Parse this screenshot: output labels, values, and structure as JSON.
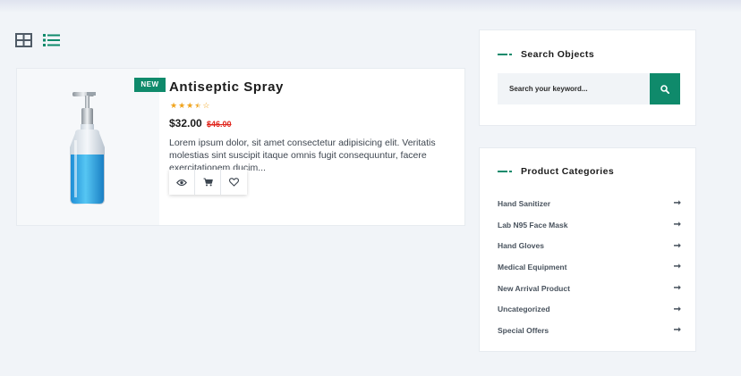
{
  "view_toggle": {
    "grid_icon": "grid-view-icon",
    "list_icon": "list-view-icon",
    "active": "list"
  },
  "product": {
    "badge": "NEW",
    "title": "Antiseptic Spray",
    "rating": 3.5,
    "rating_max": 5,
    "price": "$32.00",
    "old_price": "$46.00",
    "description": "Lorem ipsum dolor, sit amet consectetur adipisicing elit. Veritatis molestias sint suscipit itaque omnis fugit consequuntur, facere exercitationem ducim...",
    "actions": [
      "eye-icon",
      "cart-icon",
      "heart-icon"
    ]
  },
  "search_widget": {
    "title": "Search Objects",
    "placeholder": "Search your keyword...",
    "button_icon": "search-icon"
  },
  "categories_widget": {
    "title": "Product Categories",
    "items": [
      {
        "label": "Hand Sanitizer"
      },
      {
        "label": "Lab N95 Face Mask"
      },
      {
        "label": "Hand Gloves"
      },
      {
        "label": "Medical Equipment"
      },
      {
        "label": "New Arrival Product"
      },
      {
        "label": "Uncategorized"
      },
      {
        "label": "Special Offers"
      }
    ],
    "arrow_icon": "arrow-right-icon"
  },
  "colors": {
    "accent": "#0f8a6b",
    "star": "#f0a31b",
    "old_price": "#e0261d",
    "background": "#f1f4f8"
  }
}
